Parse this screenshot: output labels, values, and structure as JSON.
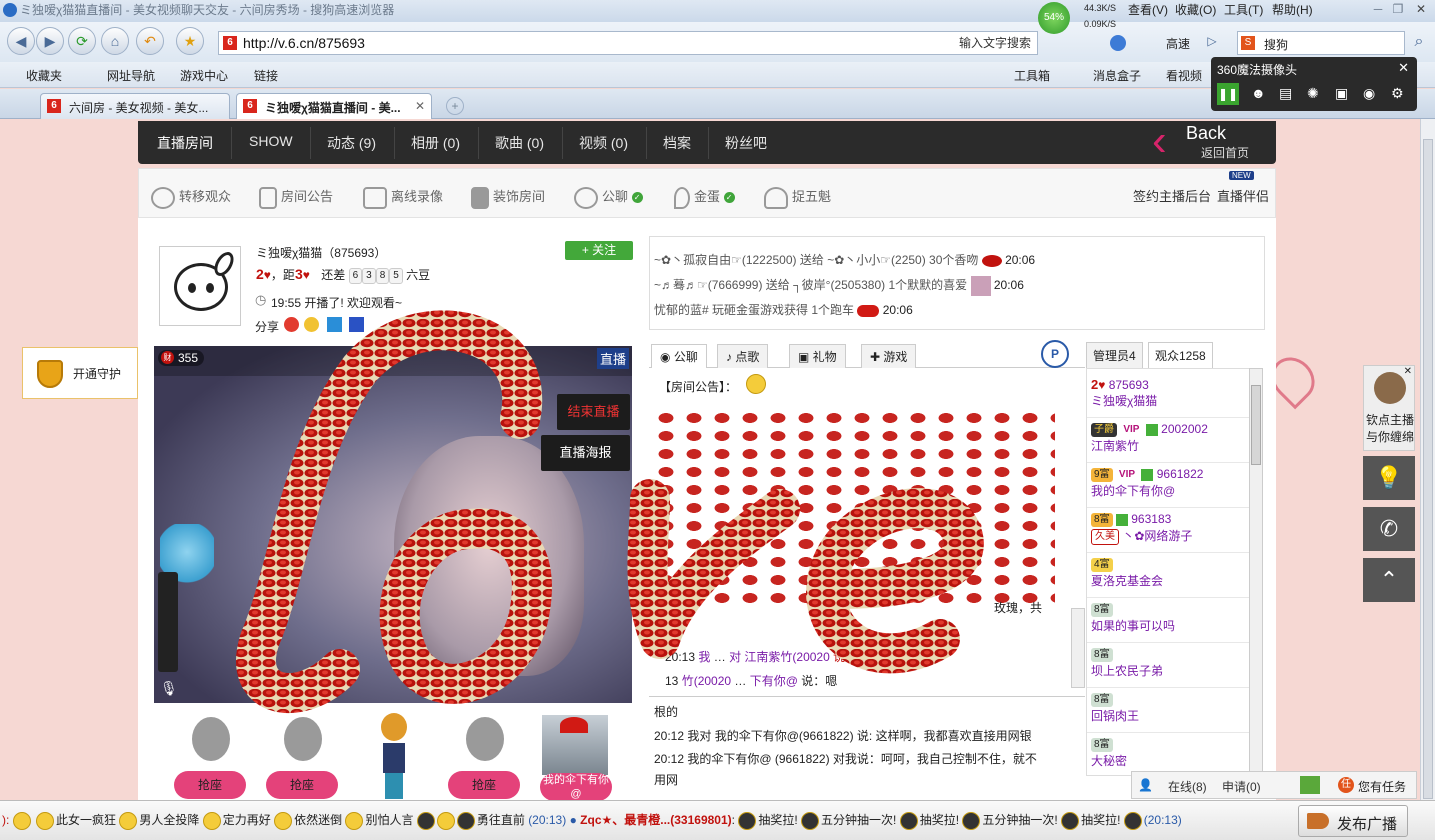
{
  "browser": {
    "title": "ミ独嗳χ猫猫直播间 - 美女视频聊天交友 - 六间房秀场 - 搜狗高速浏览器",
    "menu": [
      "查看(V)",
      "收藏(O)",
      "工具(T)",
      "帮助(H)"
    ],
    "speed": {
      "percent": "54%",
      "up": "44.3K/S",
      "down": "0.09K/S"
    },
    "url": "http://v.6.cn/875693",
    "search_hint": "输入文字搜索",
    "speed_btn": "高速",
    "search_engine": "搜狗",
    "favorites": [
      "收藏夹",
      "网址导航",
      "游戏中心",
      "链接"
    ],
    "right_tools": [
      "工具箱",
      "消息盒子",
      "看视频"
    ],
    "tabs": [
      "六间房 - 美女视频 - 美女...",
      "ミ独嗳χ猫猫直播间 - 美..."
    ],
    "camera_popup": "360魔法摄像头"
  },
  "site_nav": {
    "items": [
      "直播房间",
      "SHOW",
      "动态 (9)",
      "相册 (0)",
      "歌曲 (0)",
      "视频 (0)",
      "档案",
      "粉丝吧"
    ],
    "back": "Back",
    "back_sub": "返回首页"
  },
  "toolbar": {
    "items": [
      "转移观众",
      "房间公告",
      "离线录像",
      "装饰房间",
      "公聊",
      "金蛋",
      "捉五魁"
    ],
    "right": [
      "签约主播后台",
      "直播伴侣"
    ],
    "new_badge": "NEW"
  },
  "profile": {
    "name": "ミ独嗳χ猫猫（875693）",
    "level_a": "2",
    "dist_text": "，距",
    "level_b": "3",
    "remain": "还差",
    "digits": [
      "6",
      "3",
      "8",
      "5"
    ],
    "unit": "六豆",
    "time_msg": "19:55 开播了! 欢迎观看~",
    "share": "分享",
    "follow": "+ 关注"
  },
  "guard": "开通守护",
  "video": {
    "wealth": "355",
    "live_tag": "直播",
    "end_btn": "结束直播",
    "poster_btn": "直播海报"
  },
  "seats": {
    "label": "抢座",
    "occupied_label": "我的伞下有你@"
  },
  "gifts": [
    {
      "text": "~✿丶孤寂自由☞(1222500) 送给 ~✿丶小小☞(2250) 30个香吻",
      "time": "20:06"
    },
    {
      "text": "~♬蓦♬☞(7666999) 送给 ┐彼岸°(2505380) 1个默默的喜爱",
      "time": "20:06"
    },
    {
      "text": "忧郁的蓝# 玩砸金蛋游戏获得 1个跑车",
      "time": "20:06"
    }
  ],
  "chat": {
    "tabs": [
      "公聊",
      "点歌",
      "礼物",
      "游戏"
    ],
    "notice": "【房间公告】：",
    "fragment_right": "玫瑰，共",
    "top_lines": [
      {
        "time": "20:13",
        "left": "我",
        "mid": "对 江南紫竹(20020",
        "tail": "说：来了，"
      },
      {
        "time": "13",
        "left": "竹(20020",
        "mid": "下有你@",
        "tail": "说：嗯"
      }
    ],
    "lines": [
      "根的",
      "20:12 我对 我的伞下有你@(9661822) 说: 这样啊，我都喜欢直接用网银",
      "20:12 我的伞下有你@ (9661822) 对我说：呵呵，我自己控制不住，就不",
      "用网"
    ]
  },
  "users": {
    "tabs": [
      "管理员4",
      "观众1258"
    ],
    "list": [
      {
        "id": "875693",
        "name": "ミ独嗳χ猫猫",
        "lvl": "2"
      },
      {
        "id": "2002002",
        "name": "江南紫竹",
        "badge": "子爵"
      },
      {
        "id": "9661822",
        "name": "我的伞下有你@",
        "badge": "9富"
      },
      {
        "id": "963183",
        "name": "丶✿网络游子",
        "badge": "8富",
        "tag": "久美"
      },
      {
        "id": "",
        "name": "夏洛克基金会",
        "badge": "4富"
      },
      {
        "id": "",
        "name": "如果的事可以吗",
        "badge": "8富"
      },
      {
        "id": "",
        "name": "坝上农民子弟",
        "badge": "8富"
      },
      {
        "id": "",
        "name": "回锅肉王",
        "badge": "8富"
      },
      {
        "id": "",
        "name": "大秘密",
        "badge": "8富"
      }
    ],
    "vip": "VIP",
    "online": "在线(8)",
    "apply": "申请(0)",
    "task": "您有任务"
  },
  "side": {
    "promo": "钦点主播与你缠绵"
  },
  "bottom": {
    "ticker": [
      "此女一疯狂",
      "男人全投降",
      "定力再好",
      "依然迷倒",
      "别怕人言",
      "勇往直前",
      "(20:13)"
    ],
    "announce_name": "Zqc★、最青橙...(33169801)",
    "announce_items": [
      "抽奖拉!",
      "五分钟抽一次!",
      "抽奖拉!",
      "五分钟抽一次!",
      "抽奖拉!"
    ],
    "time_end": "(20:13)",
    "broadcast": "发布广播"
  },
  "colors": {
    "brand": "#d9261c",
    "nav_dark": "#2b2b2b",
    "rose": "#c41a14"
  }
}
